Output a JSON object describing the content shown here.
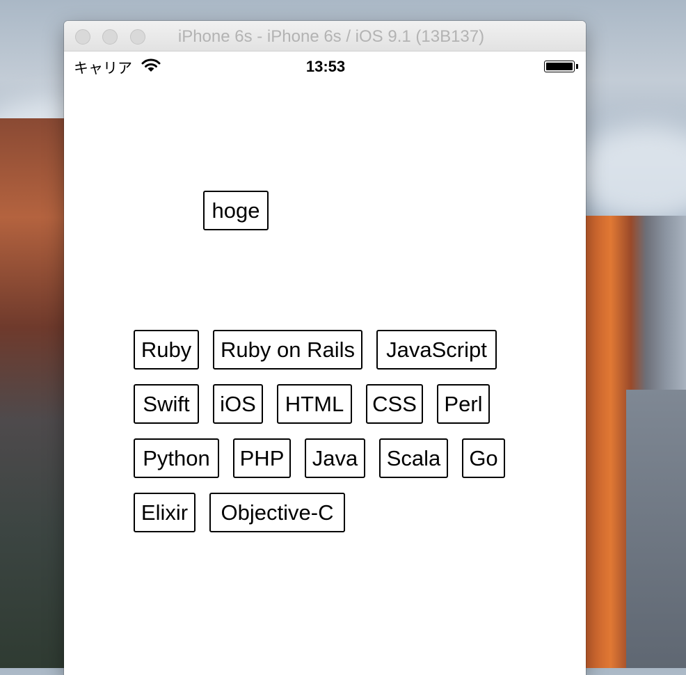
{
  "window": {
    "title": "iPhone 6s - iPhone 6s / iOS 9.1 (13B137)"
  },
  "status_bar": {
    "carrier": "キャリア",
    "wifi_icon": "wifi-icon",
    "time": "13:53",
    "battery_icon": "battery-icon",
    "battery_level": 1.0
  },
  "content": {
    "single_tag": "hoge",
    "tags": [
      "Ruby",
      "Ruby on Rails",
      "JavaScript",
      "Swift",
      "iOS",
      "HTML",
      "CSS",
      "Perl",
      "Python",
      "PHP",
      "Java",
      "Scala",
      "Go",
      "Elixir",
      "Objective-C"
    ]
  }
}
